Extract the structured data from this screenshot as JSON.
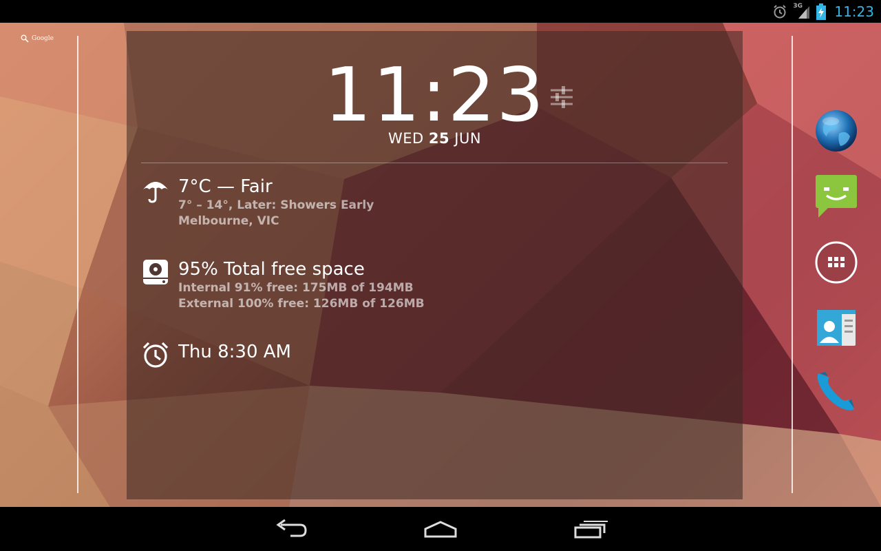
{
  "status_bar": {
    "time": "11:23",
    "network": "3G",
    "icons": [
      "alarm-icon",
      "signal-icon",
      "battery-charging-icon"
    ],
    "accent": "#33b5e5"
  },
  "google_search": {
    "label": "Google",
    "icon": "search-icon"
  },
  "widget": {
    "clock": {
      "hours": "11",
      "separator": ":",
      "minutes": "23"
    },
    "date": {
      "weekday": "WED",
      "day": "25",
      "month": "JUN"
    },
    "weather": {
      "icon": "umbrella-icon",
      "title": "7°C — Fair",
      "forecast": "7° – 14°, Later: Showers Early",
      "location": "Melbourne, VIC"
    },
    "storage": {
      "icon": "hard-drive-icon",
      "title": "95% Total free space",
      "internal": "Internal 91% free: 175MB of 194MB",
      "external": "External 100% free: 126MB of 126MB"
    },
    "alarm": {
      "icon": "alarm-clock-icon",
      "title": "Thu 8:30 AM"
    }
  },
  "dock": [
    "browser-globe-icon",
    "messaging-icon",
    "app-drawer-icon",
    "contacts-icon",
    "phone-icon"
  ],
  "nav_bar": [
    "back-icon",
    "home-icon",
    "recent-apps-icon"
  ]
}
